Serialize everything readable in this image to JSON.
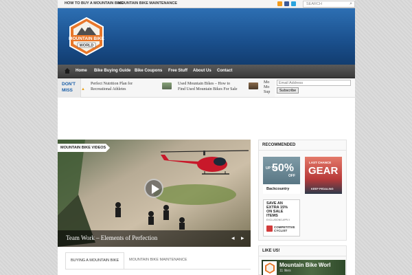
{
  "topnav": {
    "links": [
      "HOW TO BUY A MOUNTAIN BIKE",
      "MOUNTAIN BIKE MAINTENANCE"
    ],
    "social_icons": [
      "rss-icon",
      "facebook-icon",
      "twitter-icon"
    ],
    "search_placeholder": "SEARCH"
  },
  "logo": {
    "line1": "MOUNTAIN BIKE",
    "line2": "WORLD"
  },
  "menu": {
    "items": [
      "Home",
      "Bike Buying Guide",
      "Bike Coupons",
      "Free Stuff",
      "About Us",
      "Contact"
    ]
  },
  "dont_miss": {
    "label_line1": "DON'T",
    "label_line2": "MISS",
    "items": [
      {
        "title_line1": "Perfect Nutrition Plan for",
        "title_line2": "Recreational Athletes"
      },
      {
        "title_line1": "Used Mountain Bikes – How to",
        "title_line2": "Find Used Mountain Bikes For Sale"
      },
      {
        "title_line1": "Mo",
        "title_line2": "Mo",
        "title_line3": "Sup"
      }
    ]
  },
  "newsletter": {
    "email_placeholder": "Email Address",
    "subscribe_label": "Subscribe"
  },
  "video": {
    "section_label": "MOUNTAIN BIKE VIDEOS",
    "caption": "Team Work – Elements of Perfection",
    "prev": "◂",
    "next": "▸"
  },
  "tabs": [
    "BUYING A MOUNTAIN BIKE",
    "MOUNTAIN BIKE MAINTENANCE"
  ],
  "sidebar": {
    "recommended_title": "RECOMMENDED",
    "ads": [
      {
        "line1": "UP TO",
        "big": "50%",
        "small": "OFF",
        "brand": "Backcountry"
      },
      {
        "line1": "LAST CHANCE",
        "big": "GEAR",
        "brand": "KEEP PEDALING"
      },
      {
        "line1": "SAVE AN",
        "line2": "EXTRA 15%",
        "line3": "ON SALE",
        "line4": "ITEMS",
        "line5": "EXCLUSIONS APPLY",
        "brand_line1": "COMPETITIVE",
        "brand_line2": "CYCLIST"
      }
    ],
    "like_title": "LIKE US!",
    "fb_page_name": "Mountain Bike Worl",
    "fb_meta": "11 likes"
  },
  "colors": {
    "header_blue": "#1a4f8c",
    "accent_blue": "#1a5ea8",
    "logo_orange": "#e8772a",
    "menu_dark": "#3a3a3a"
  }
}
